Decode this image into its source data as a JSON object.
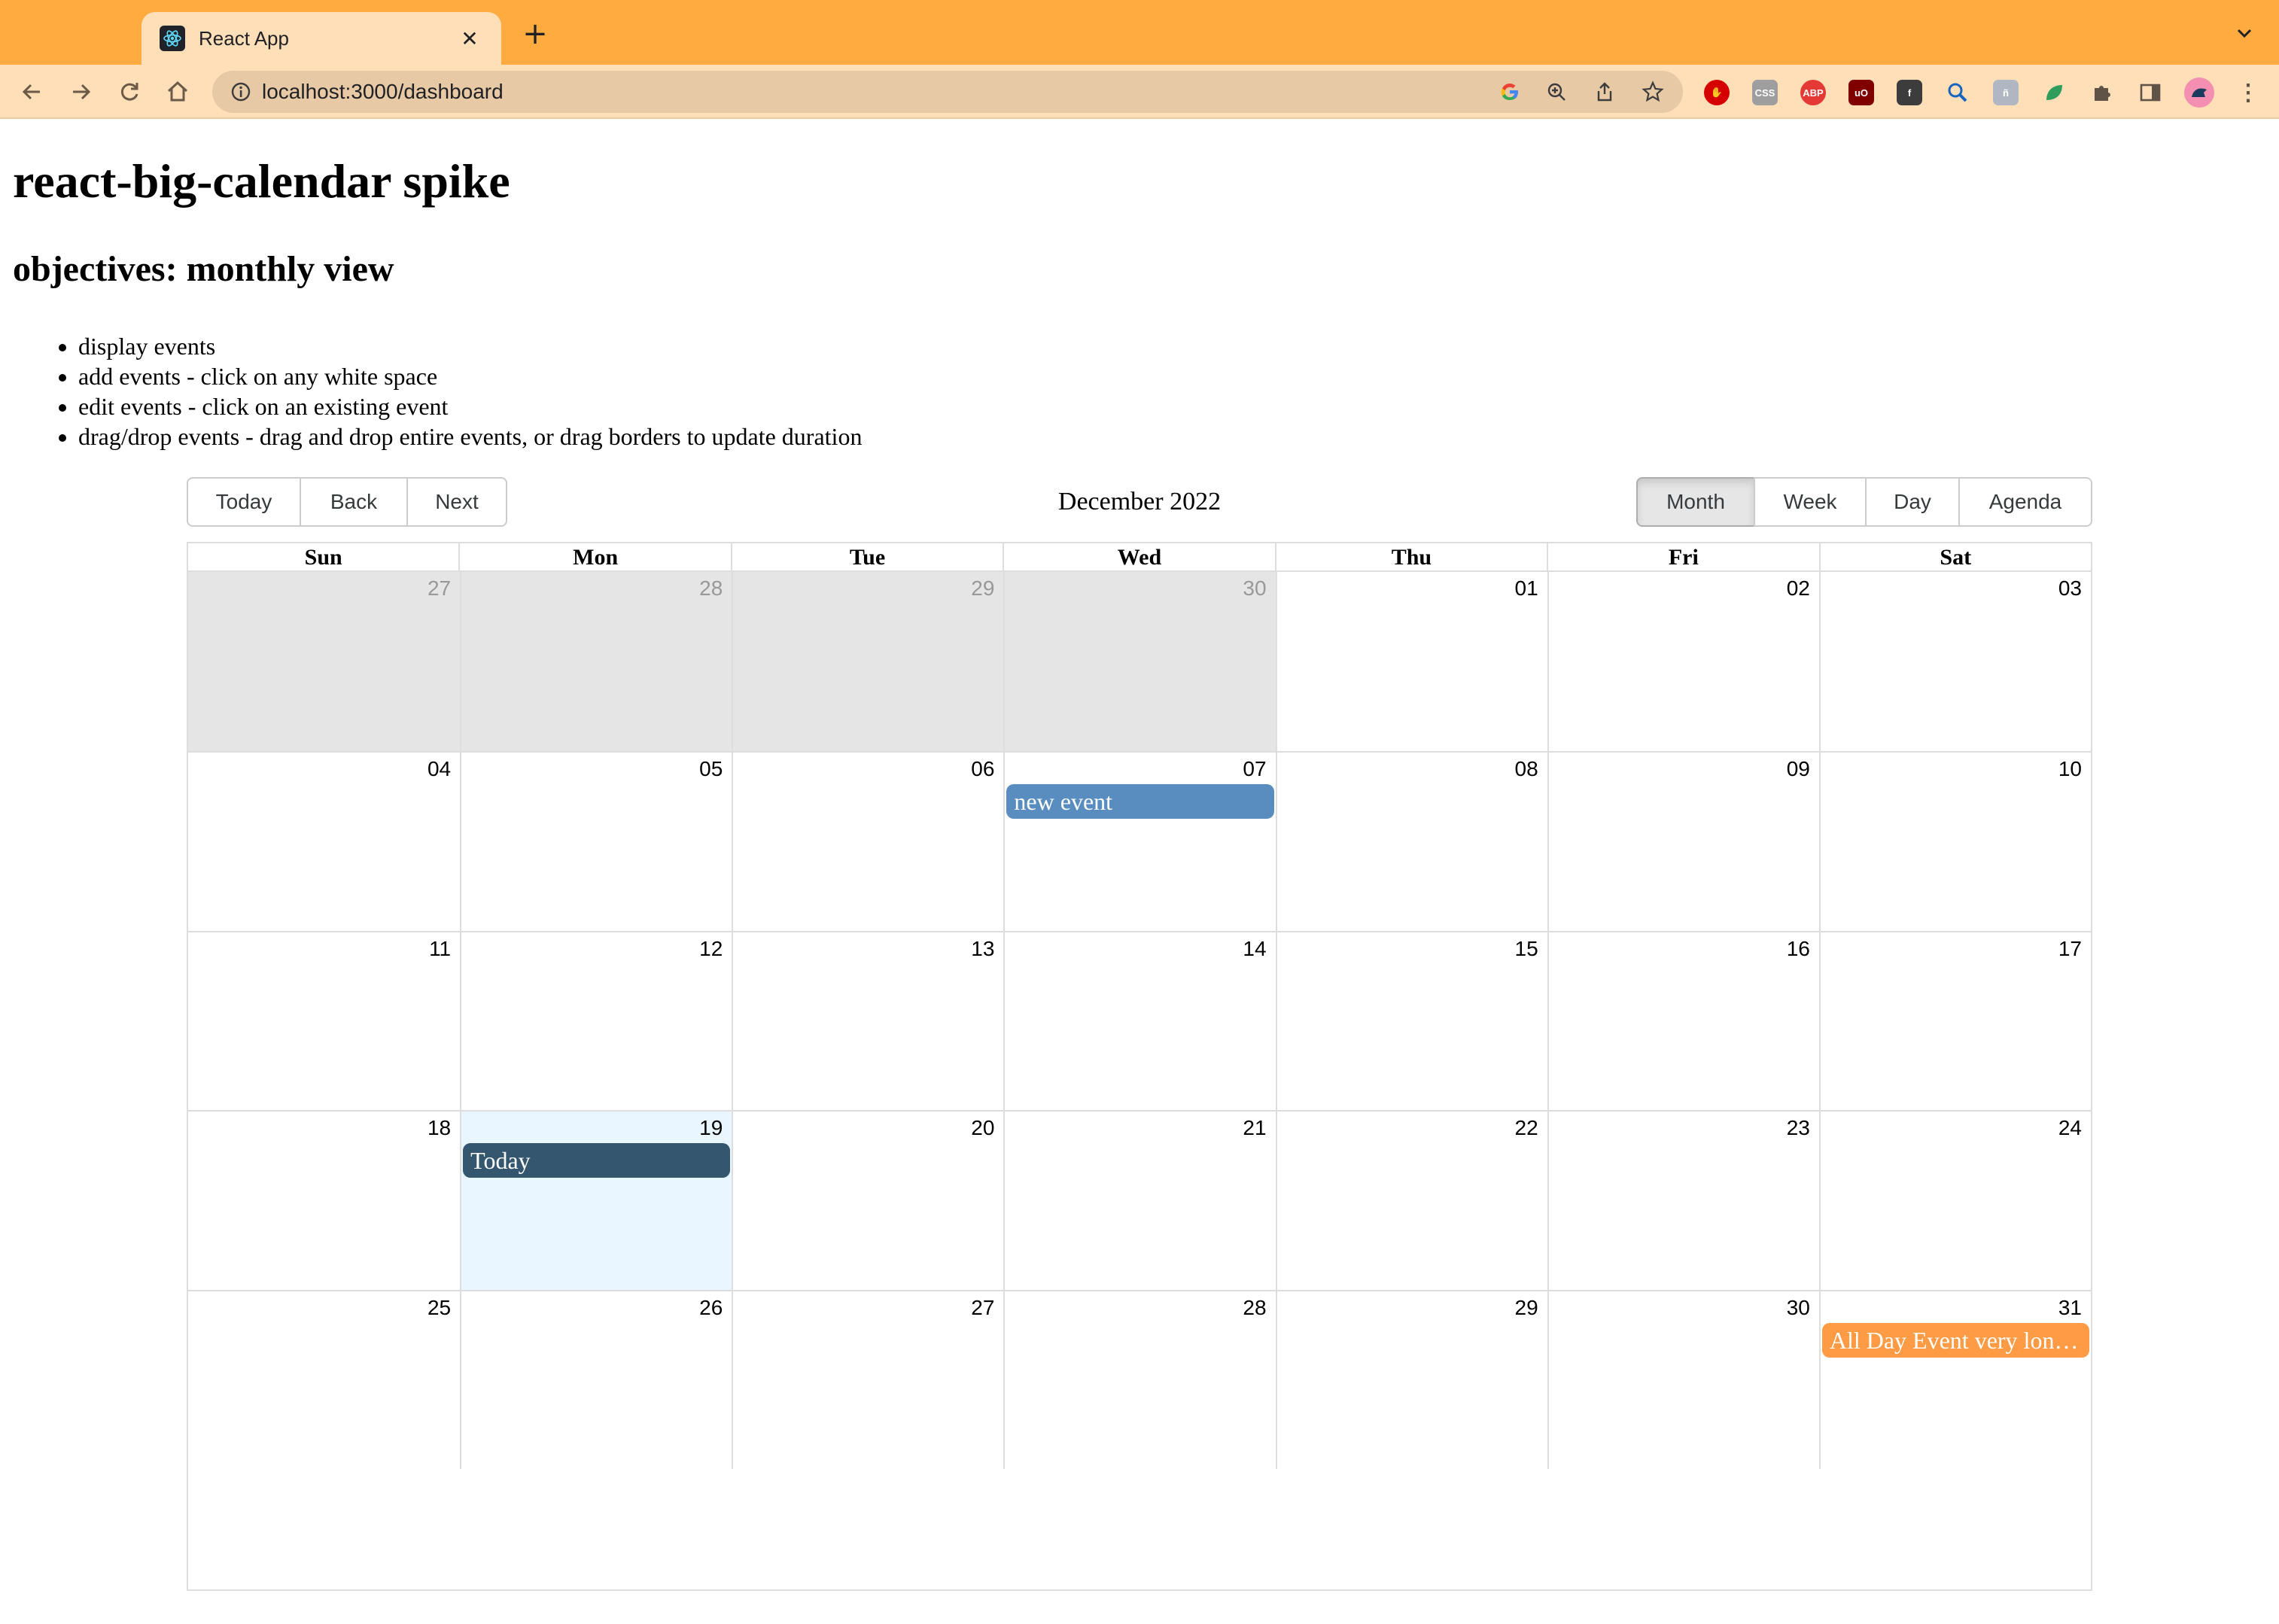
{
  "browser": {
    "tab_title": "React App",
    "url": "localhost:3000/dashboard"
  },
  "page": {
    "title": "react-big-calendar spike",
    "subtitle": "objectives: monthly view",
    "objectives": [
      "display events",
      "add events - click on any white space",
      "edit events - click on an existing event",
      "drag/drop events - drag and drop entire events, or drag borders to update duration"
    ]
  },
  "calendar": {
    "nav_buttons": [
      "Today",
      "Back",
      "Next"
    ],
    "label": "December 2022",
    "views": [
      "Month",
      "Week",
      "Day",
      "Agenda"
    ],
    "active_view": "Month",
    "weekdays": [
      "Sun",
      "Mon",
      "Tue",
      "Wed",
      "Thu",
      "Fri",
      "Sat"
    ],
    "weeks": [
      [
        {
          "d": "27",
          "off": true
        },
        {
          "d": "28",
          "off": true
        },
        {
          "d": "29",
          "off": true
        },
        {
          "d": "30",
          "off": true
        },
        {
          "d": "01"
        },
        {
          "d": "02"
        },
        {
          "d": "03"
        }
      ],
      [
        {
          "d": "04"
        },
        {
          "d": "05"
        },
        {
          "d": "06"
        },
        {
          "d": "07"
        },
        {
          "d": "08"
        },
        {
          "d": "09"
        },
        {
          "d": "10"
        }
      ],
      [
        {
          "d": "11"
        },
        {
          "d": "12"
        },
        {
          "d": "13"
        },
        {
          "d": "14"
        },
        {
          "d": "15"
        },
        {
          "d": "16"
        },
        {
          "d": "17"
        }
      ],
      [
        {
          "d": "18"
        },
        {
          "d": "19",
          "today": true
        },
        {
          "d": "20"
        },
        {
          "d": "21"
        },
        {
          "d": "22"
        },
        {
          "d": "23"
        },
        {
          "d": "24"
        }
      ],
      [
        {
          "d": "25"
        },
        {
          "d": "26"
        },
        {
          "d": "27"
        },
        {
          "d": "28"
        },
        {
          "d": "29"
        },
        {
          "d": "30"
        },
        {
          "d": "31"
        }
      ]
    ],
    "events": [
      {
        "title": "new event",
        "week": 1,
        "day": 3,
        "color": "#5a8dbf"
      },
      {
        "title": "Today",
        "week": 3,
        "day": 1,
        "color": "#34566f"
      },
      {
        "title": "All Day Event very long title",
        "week": 4,
        "day": 6,
        "color": "#ff9b45"
      }
    ],
    "colors": {
      "offrange_bg": "#e5e5e5",
      "today_bg": "#eaf6ff",
      "border": "#dddddd"
    }
  }
}
